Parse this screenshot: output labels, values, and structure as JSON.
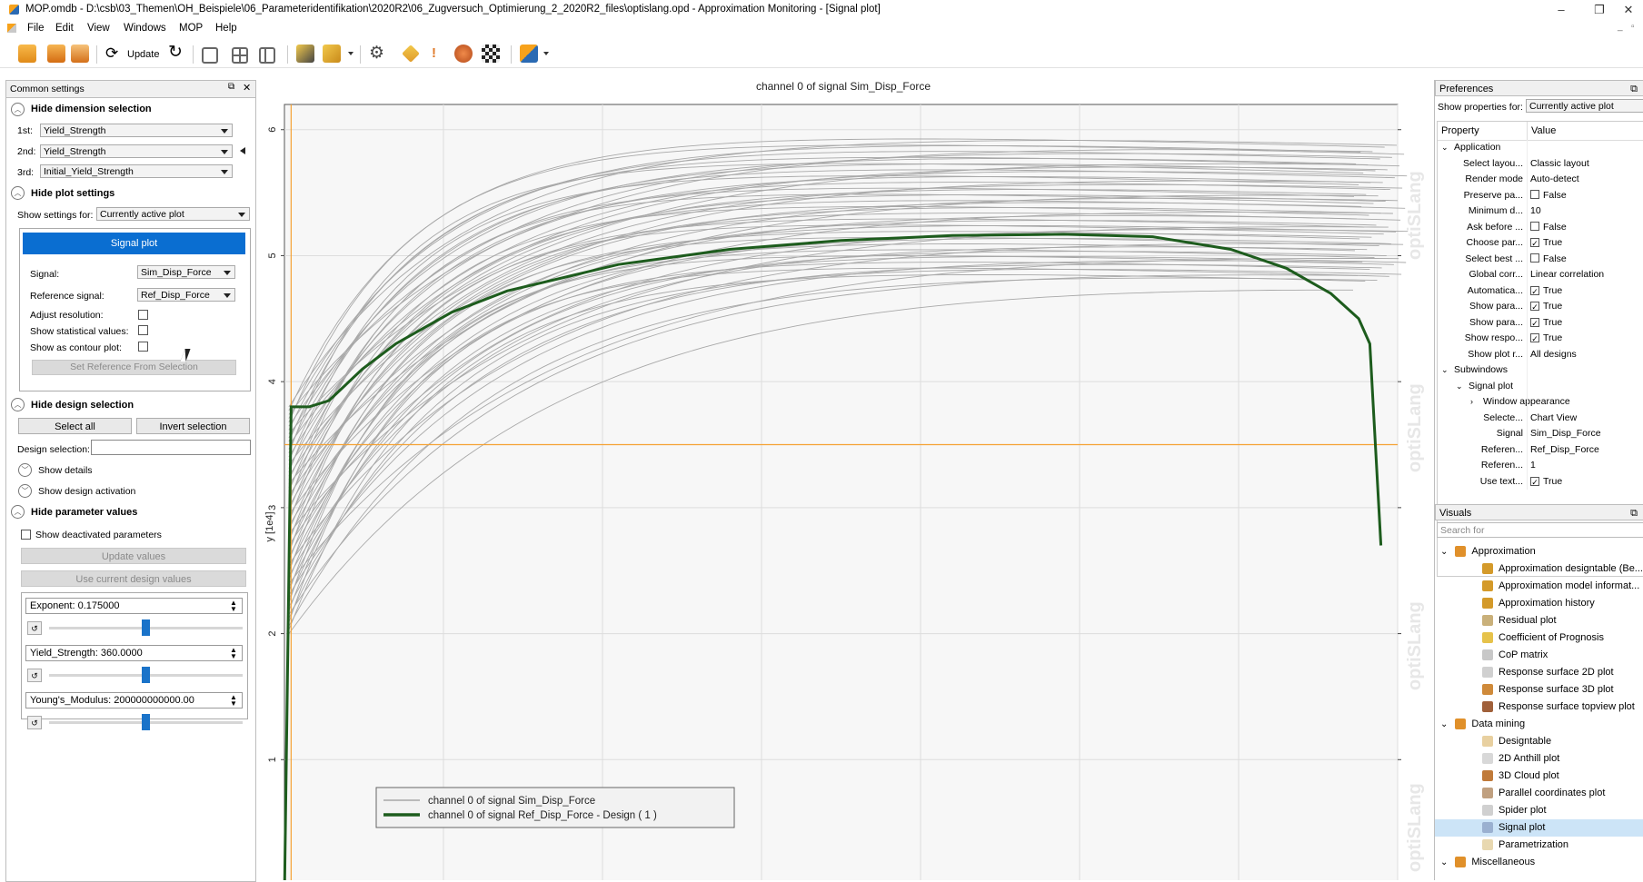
{
  "window": {
    "title": "MOP.omdb - D:\\csb\\03_Themen\\OH_Beispiele\\06_Parameteridentifikation\\2020R2\\06_Zugversuch_Optimierung_2_2020R2_files\\optislang.opd - Approximation Monitoring - [Signal plot]",
    "controls": {
      "minimize": "–",
      "restore": "❐",
      "close": "✕"
    }
  },
  "menu": [
    "File",
    "Edit",
    "View",
    "Windows",
    "MOP",
    "Help"
  ],
  "toolbar": {
    "update_label": "Update"
  },
  "left": {
    "header": "Common settings",
    "dim": {
      "title": "Hide dimension selection",
      "rows": [
        {
          "label": "1st:",
          "value": "Yield_Strength"
        },
        {
          "label": "2nd:",
          "value": "Yield_Strength"
        },
        {
          "label": "3rd:",
          "value": "Initial_Yield_Strength"
        }
      ]
    },
    "plot": {
      "title": "Hide plot settings",
      "show_for_label": "Show settings for:",
      "show_for_value": "Currently active plot",
      "tab": "Signal plot",
      "signal_label": "Signal:",
      "signal_value": "Sim_Disp_Force",
      "ref_label": "Reference signal:",
      "ref_value": "Ref_Disp_Force",
      "adjust_label": "Adjust resolution:",
      "stat_label": "Show statistical values:",
      "contour_label": "Show as contour plot:",
      "set_ref_btn": "Set Reference From Selection"
    },
    "design": {
      "title": "Hide design selection",
      "select_all": "Select all",
      "invert": "Invert selection",
      "ds_label": "Design selection:",
      "ds_value": "",
      "details": "Show details",
      "activation": "Show design activation"
    },
    "params": {
      "title": "Hide parameter values",
      "show_deact": "Show deactivated parameters",
      "update_btn": "Update values",
      "use_current_btn": "Use current design values",
      "items": [
        {
          "label": "Exponent: 0.175000",
          "level": 0.5
        },
        {
          "label": "Yield_Strength: 360.0000",
          "level": 0.5
        },
        {
          "label": "Young's_Modulus: 200000000000.00",
          "level": 0.5
        }
      ]
    }
  },
  "plot": {
    "title": "channel 0 of signal Sim_Disp_Force",
    "ylabel": "y [1e4]",
    "legend": [
      "channel 0 of signal Sim_Disp_Force",
      "channel 0 of signal Ref_Disp_Force - Design ( 1 )"
    ],
    "watermark": "optiSLang"
  },
  "chart_data": {
    "type": "line",
    "ylabel": "y [1e4]",
    "ylim": [
      0,
      6.2
    ],
    "yticks": [
      "1",
      "2",
      "3",
      "4",
      "5",
      "6"
    ],
    "x_normalized_range": [
      0,
      1
    ],
    "reference_series": {
      "name": "channel 0 of signal Ref_Disp_Force - Design ( 1 )",
      "color": "#1d5c1d",
      "x": [
        0,
        0.006,
        0.012,
        0.022,
        0.04,
        0.07,
        0.1,
        0.15,
        0.2,
        0.3,
        0.4,
        0.5,
        0.6,
        0.7,
        0.78,
        0.85,
        0.9,
        0.94,
        0.965,
        0.975,
        0.985
      ],
      "y": [
        -0.1,
        3.8,
        3.8,
        3.8,
        3.85,
        4.1,
        4.3,
        4.55,
        4.72,
        4.93,
        5.05,
        5.12,
        5.16,
        5.17,
        5.15,
        5.05,
        4.9,
        4.7,
        4.5,
        4.3,
        2.7
      ]
    },
    "simulation_series": {
      "name": "channel 0 of signal Sim_Disp_Force",
      "color": "#a8a8a8",
      "count": 60,
      "final_y_range": [
        4.9,
        6.0
      ]
    },
    "marker_lines": {
      "color": "#f5a234",
      "x": 0.006,
      "y": 3.5
    },
    "grid": true
  },
  "right": {
    "prefs_header": "Preferences",
    "show_props_label": "Show properties for:",
    "show_props_value": "Currently active plot",
    "col_property": "Property",
    "col_value": "Value",
    "rows": [
      {
        "p": "Application",
        "v": "",
        "lvl": 0,
        "exp": "v"
      },
      {
        "p": "Select layou...",
        "v": "Classic layout",
        "lvl": 1
      },
      {
        "p": "Render mode",
        "v": "Auto-detect",
        "lvl": 1
      },
      {
        "p": "Preserve pa...",
        "v": "False",
        "lvl": 1,
        "chk": false
      },
      {
        "p": "Minimum d...",
        "v": "10",
        "lvl": 1
      },
      {
        "p": "Ask before ...",
        "v": "False",
        "lvl": 1,
        "chk": false
      },
      {
        "p": "Choose par...",
        "v": "True",
        "lvl": 1,
        "chk": true
      },
      {
        "p": "Select best ...",
        "v": "False",
        "lvl": 1,
        "chk": false
      },
      {
        "p": "Global corr...",
        "v": "Linear correlation",
        "lvl": 1
      },
      {
        "p": "Automatica...",
        "v": "True",
        "lvl": 1,
        "chk": true
      },
      {
        "p": "Show para...",
        "v": "True",
        "lvl": 1,
        "chk": true
      },
      {
        "p": "Show para...",
        "v": "True",
        "lvl": 1,
        "chk": true
      },
      {
        "p": "Show respo...",
        "v": "True",
        "lvl": 1,
        "chk": true
      },
      {
        "p": "Show plot r...",
        "v": "All designs",
        "lvl": 1
      },
      {
        "p": "Subwindows",
        "v": "",
        "lvl": 0,
        "exp": "v"
      },
      {
        "p": "Signal plot",
        "v": "",
        "lvl": 1,
        "exp": "v"
      },
      {
        "p": "Window appearance",
        "v": "",
        "lvl": 2,
        "exp": ">"
      },
      {
        "p": "Selecte...",
        "v": "Chart View",
        "lvl": 2
      },
      {
        "p": "Signal",
        "v": "Sim_Disp_Force",
        "lvl": 2
      },
      {
        "p": "Referen...",
        "v": "Ref_Disp_Force",
        "lvl": 2
      },
      {
        "p": "Referen...",
        "v": "1",
        "lvl": 2
      },
      {
        "p": "Use text...",
        "v": "True",
        "lvl": 2,
        "chk": true
      }
    ],
    "visuals_header": "Visuals",
    "search_placeholder": "Search for",
    "visuals": [
      {
        "t": "Approximation",
        "lvl": 0,
        "folder": true,
        "color": "#e0902a"
      },
      {
        "t": "Approximation designtable (Be...",
        "lvl": 1,
        "color": "#d49a2a"
      },
      {
        "t": "Approximation model informat...",
        "lvl": 1,
        "color": "#d49a2a"
      },
      {
        "t": "Approximation history",
        "lvl": 1,
        "color": "#d49a2a"
      },
      {
        "t": "Residual plot",
        "lvl": 1,
        "color": "#c9b07a"
      },
      {
        "t": "Coefficient of Prognosis",
        "lvl": 1,
        "color": "#e6c24a"
      },
      {
        "t": "CoP matrix",
        "lvl": 1,
        "color": "#c8c8c8"
      },
      {
        "t": "Response surface 2D plot",
        "lvl": 1,
        "color": "#d0d0d0"
      },
      {
        "t": "Response surface 3D plot",
        "lvl": 1,
        "color": "#cf8a3a"
      },
      {
        "t": "Response surface topview plot",
        "lvl": 1,
        "color": "#a0603a"
      },
      {
        "t": "Data mining",
        "lvl": 0,
        "folder": true,
        "color": "#e0902a"
      },
      {
        "t": "Designtable",
        "lvl": 1,
        "color": "#e8d0a0"
      },
      {
        "t": "2D Anthill plot",
        "lvl": 1,
        "color": "#d8d8d8"
      },
      {
        "t": "3D Cloud plot",
        "lvl": 1,
        "color": "#c07a3a"
      },
      {
        "t": "Parallel coordinates plot",
        "lvl": 1,
        "color": "#c0a080"
      },
      {
        "t": "Spider plot",
        "lvl": 1,
        "color": "#d0d0d0"
      },
      {
        "t": "Signal plot",
        "lvl": 1,
        "color": "#9ab0d0",
        "selected": true
      },
      {
        "t": "Parametrization",
        "lvl": 1,
        "color": "#e8d8b0"
      },
      {
        "t": "Miscellaneous",
        "lvl": 0,
        "folder": true,
        "color": "#e0902a"
      }
    ]
  }
}
